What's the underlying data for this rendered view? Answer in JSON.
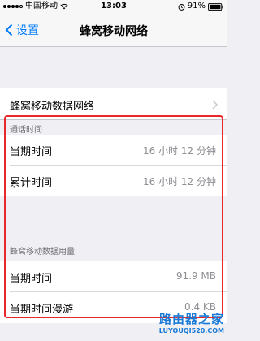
{
  "status_bar": {
    "carrier": "中国移动",
    "time": "13:03",
    "battery": "91%",
    "signal_bars_filled": 4,
    "signal_bars_total": 5
  },
  "nav": {
    "back_label": "设置",
    "title": "蜂窝移动网络"
  },
  "cellular_data_network": {
    "label": "蜂窝移动数据网络"
  },
  "call_time": {
    "header": "通话时间",
    "rows": [
      {
        "label": "当期时间",
        "value": "16 小时 12 分钟"
      },
      {
        "label": "累计时间",
        "value": "16 小时 12 分钟"
      }
    ]
  },
  "cellular_data_usage": {
    "header": "蜂窝移动数据用量",
    "rows": [
      {
        "label": "当期时间",
        "value": "91.9 MB"
      },
      {
        "label": "当期时间漫游",
        "value": "0.4 KB"
      }
    ]
  },
  "watermark": {
    "title": "路由器之家",
    "url": "LUYOUQI520.COM"
  },
  "colors": {
    "accent": "#007aff",
    "highlight": "#e8282b",
    "background": "#efeff4",
    "watermark": "#1a7ad6"
  },
  "icons": [
    "signal-icon",
    "wifi-icon",
    "alarm-icon",
    "battery-icon",
    "back-chevron-icon",
    "chevron-right-icon"
  ]
}
